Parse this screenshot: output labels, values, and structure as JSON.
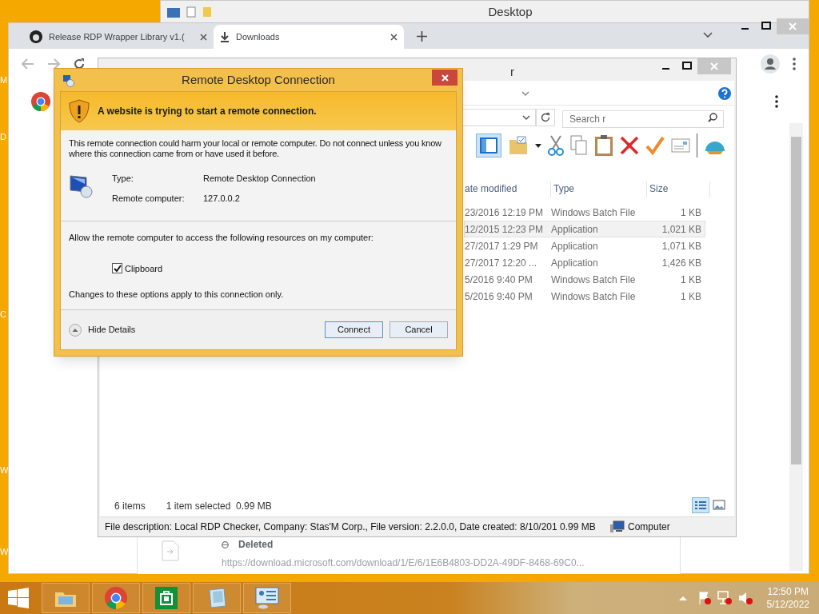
{
  "desktop": {
    "edge_labels": [
      "M",
      "D",
      "C",
      "W",
      "W"
    ]
  },
  "back_window": {
    "title": "Desktop"
  },
  "browser": {
    "tabs": [
      {
        "label": "Release RDP Wrapper Library v1.(",
        "selected": false
      },
      {
        "label": "Downloads",
        "selected": true
      }
    ],
    "download": {
      "status": "Deleted",
      "url": "https://download.microsoft.com/download/1/E/6/1E6B4803-DD2A-49DF-8468-69C0..."
    }
  },
  "explorer": {
    "title": "r",
    "search": {
      "placeholder": "Search r"
    },
    "columns": [
      "ate modified",
      "Type",
      "Size"
    ],
    "rows": [
      {
        "date": "23/2016 12:19 PM",
        "type": "Windows Batch File",
        "size": "1 KB",
        "selected": false
      },
      {
        "date": "12/2015 12:23 PM",
        "type": "Application",
        "size": "1,021 KB",
        "selected": true
      },
      {
        "date": "27/2017 1:29 PM",
        "type": "Application",
        "size": "1,071 KB",
        "selected": false
      },
      {
        "date": "27/2017 12:20 ...",
        "type": "Application",
        "size": "1,426 KB",
        "selected": false
      },
      {
        "date": "5/2016 9:40 PM",
        "type": "Windows Batch File",
        "size": "1 KB",
        "selected": false
      },
      {
        "date": "5/2016 9:40 PM",
        "type": "Windows Batch File",
        "size": "1 KB",
        "selected": false
      }
    ],
    "status": {
      "items": "6 items",
      "selection": "1 item selected  0.99 MB"
    },
    "details": "File description: Local RDP Checker, Company: Stas'M Corp., File version: 2.2.0.0, Date created: 8/10/201 0.99 MB",
    "location": "Computer"
  },
  "dialog": {
    "title": "Remote Desktop Connection",
    "warning": "A website is trying to start a remote connection.",
    "description": "This remote connection could harm your local or remote computer. Do not connect unless you know where this connection came from or have used it before.",
    "fields": [
      {
        "label": "Type:",
        "value": "Remote Desktop Connection"
      },
      {
        "label": "Remote computer:",
        "value": "127.0.0.2"
      }
    ],
    "resources_prompt": "Allow the remote computer to access the following resources on my computer:",
    "options": [
      {
        "label": "Clipboard",
        "checked": true
      }
    ],
    "note": "Changes to these options apply to this connection only.",
    "details_toggle": "Hide Details",
    "buttons": [
      {
        "label": "Connect",
        "default": true
      },
      {
        "label": "Cancel",
        "default": false
      }
    ]
  },
  "taskbar": {
    "time": "12:50 PM",
    "date": "5/12/2022"
  }
}
